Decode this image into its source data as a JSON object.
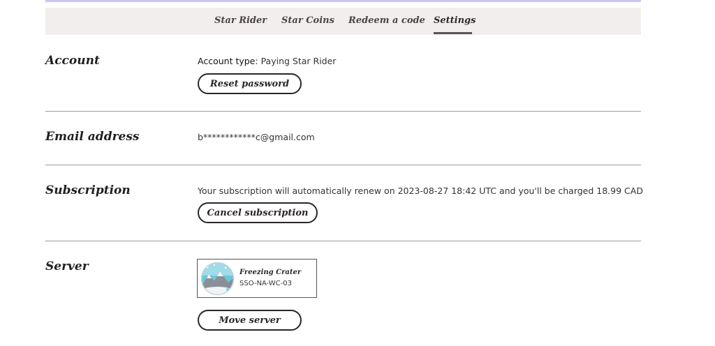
{
  "nav": {
    "tabs": [
      {
        "label": "Star Rider"
      },
      {
        "label": "Star Coins"
      },
      {
        "label": "Redeem a code"
      },
      {
        "label": "Settings"
      }
    ],
    "active_tab": "Settings"
  },
  "account": {
    "title": "Account",
    "type_key": "Account type",
    "type_value": "Paying Star Rider",
    "reset_password_label": "Reset password"
  },
  "email": {
    "title": "Email address",
    "value": "b************c@gmail.com"
  },
  "subscription": {
    "title": "Subscription",
    "renewal_text": "Your subscription will automatically renew on 2023-08-27 18:42 UTC and you'll be charged 18.99 CAD",
    "cancel_label": "Cancel subscription"
  },
  "server": {
    "title": "Server",
    "name": "Freezing Crater",
    "code": "SSO-NA-WC-03",
    "icon": "freezing-crater-icon",
    "move_label": "Move server"
  },
  "colors": {
    "accent_bar": "#c9c6f3",
    "tabbar_bg": "#f1eeed",
    "ink": "#2a2626"
  }
}
